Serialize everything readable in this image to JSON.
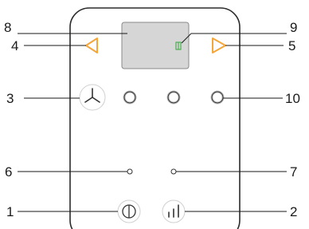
{
  "callouts": {
    "c1": "1",
    "c2": "2",
    "c3": "3",
    "c4": "4",
    "c5": "5",
    "c6": "6",
    "c7": "7",
    "c8": "8",
    "c9": "9",
    "c10": "10"
  },
  "colors": {
    "outline": "#2b2b2b",
    "arrow_accent": "#f4a63a",
    "display_fill": "#d6d6d6",
    "display_border": "#8a8a8a",
    "display_icon": "#4caf50",
    "button_ring": "#bdbdbd",
    "leader_line": "#1a1a1a"
  },
  "icons": {
    "left_arrow": "triangle-left-icon",
    "right_arrow": "triangle-right-icon",
    "fan": "fan-icon",
    "power": "power-icon",
    "levels": "bar-levels-icon",
    "display_symbol": "door-exit-icon"
  }
}
